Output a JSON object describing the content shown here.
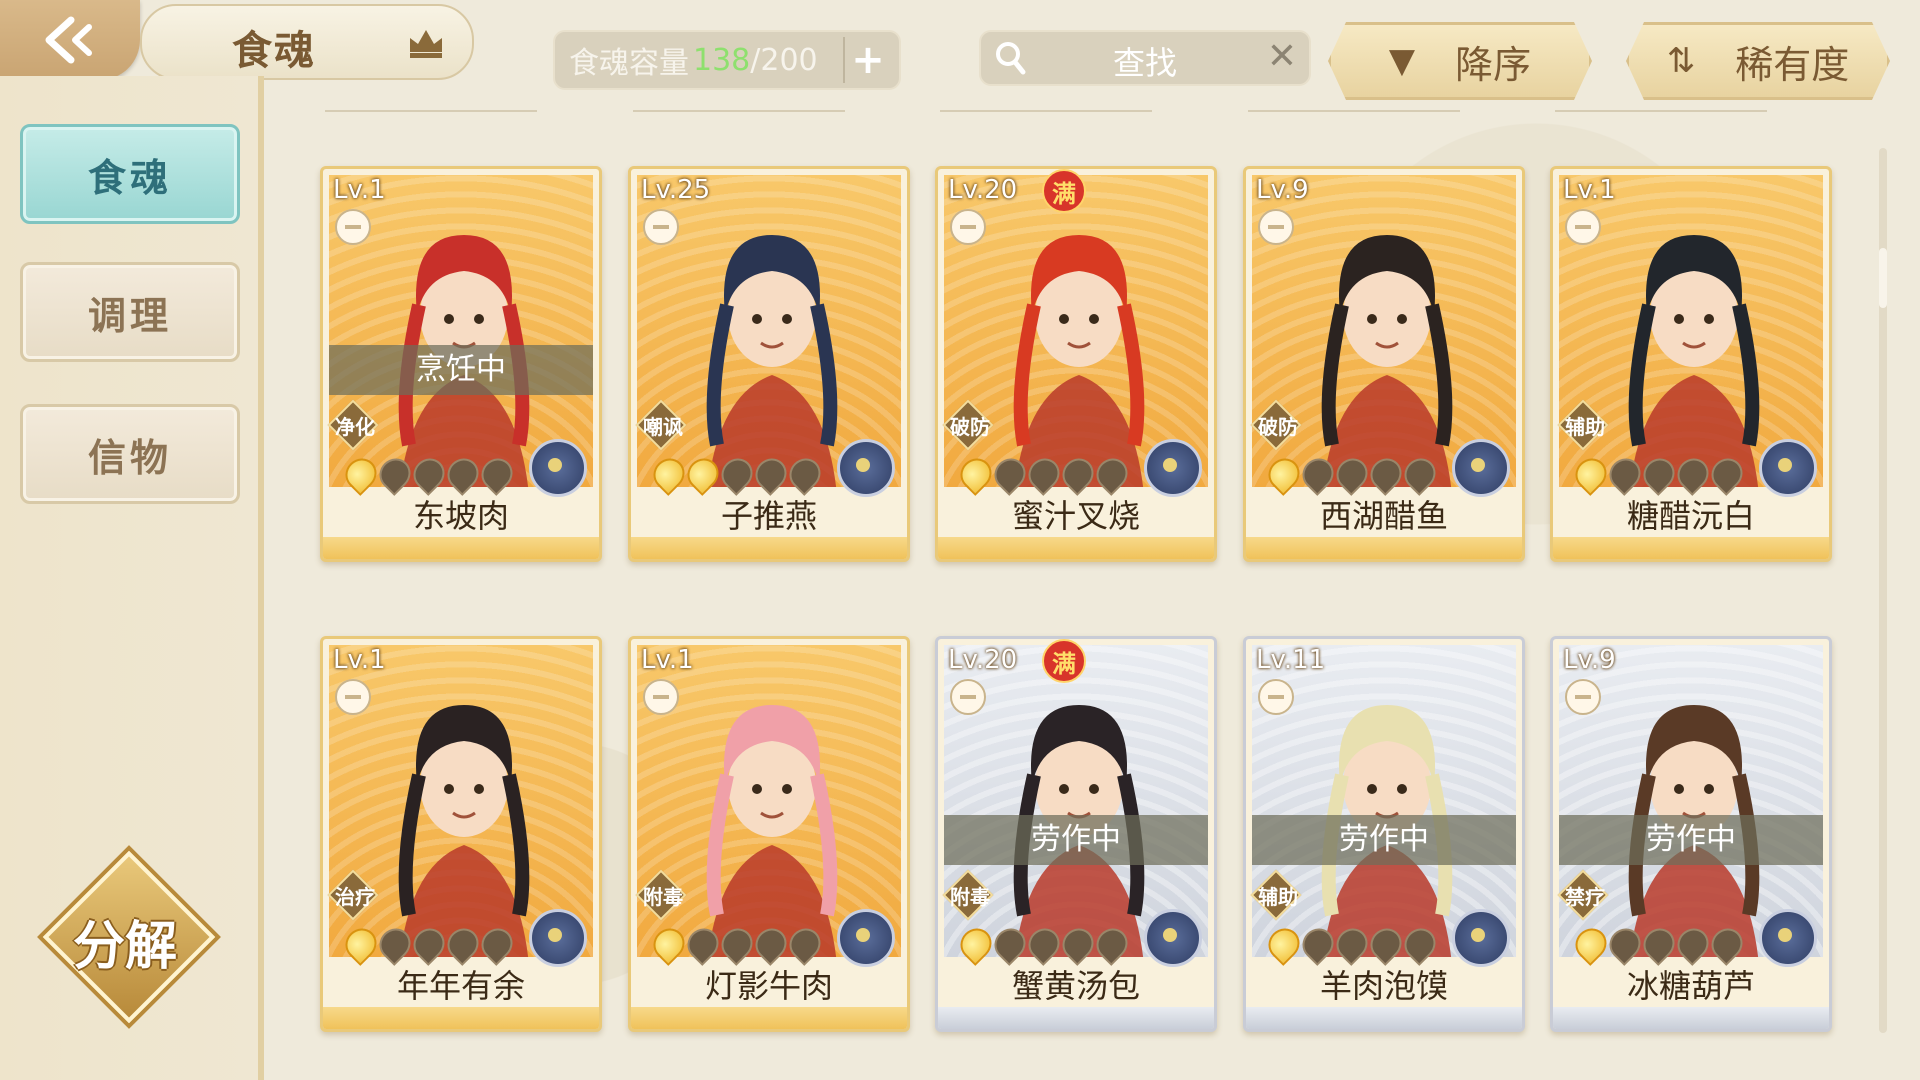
{
  "header": {
    "title": "食魂",
    "capacity_label": "食魂容量",
    "capacity_current": "138",
    "capacity_separator": "/",
    "capacity_max": "200",
    "add_label": "+",
    "search_placeholder": "查找",
    "clear_label": "✕",
    "sort_order_label": "降序",
    "sort_key_label": "稀有度"
  },
  "sidebar": {
    "items": [
      {
        "label": "食魂",
        "active": true
      },
      {
        "label": "调理",
        "active": false
      },
      {
        "label": "信物",
        "active": false
      }
    ],
    "decompose_label": "分解"
  },
  "cards": [
    {
      "level": "Lv.1",
      "name": "东坡肉",
      "role": "净化",
      "status": "烹饪中",
      "full": false,
      "stars": 1,
      "frame": "gold",
      "hair": "#c8302a"
    },
    {
      "level": "Lv.25",
      "name": "子推燕",
      "role": "嘲讽",
      "status": "",
      "full": false,
      "stars": 2,
      "frame": "gold",
      "hair": "#2a3552"
    },
    {
      "level": "Lv.20",
      "name": "蜜汁叉烧",
      "role": "破防",
      "status": "",
      "full": true,
      "stars": 1,
      "frame": "gold",
      "hair": "#d83a22"
    },
    {
      "level": "Lv.9",
      "name": "西湖醋鱼",
      "role": "破防",
      "status": "",
      "full": false,
      "stars": 1,
      "frame": "gold",
      "hair": "#2b2320"
    },
    {
      "level": "Lv.1",
      "name": "糖醋沅白",
      "role": "辅助",
      "status": "",
      "full": false,
      "stars": 1,
      "frame": "gold",
      "hair": "#22262c"
    },
    {
      "level": "Lv.1",
      "name": "年年有余",
      "role": "治疗",
      "status": "",
      "full": false,
      "stars": 1,
      "frame": "gold",
      "hair": "#2a2222"
    },
    {
      "level": "Lv.1",
      "name": "灯影牛肉",
      "role": "附毒",
      "status": "",
      "full": false,
      "stars": 1,
      "frame": "gold",
      "hair": "#f0a0a8"
    },
    {
      "level": "Lv.20",
      "name": "蟹黄汤包",
      "role": "附毒",
      "status": "劳作中",
      "full": true,
      "stars": 1,
      "frame": "silver",
      "hair": "#2a2326"
    },
    {
      "level": "Lv.11",
      "name": "羊肉泡馍",
      "role": "辅助",
      "status": "劳作中",
      "full": false,
      "stars": 1,
      "frame": "silver",
      "hair": "#e8e0b0"
    },
    {
      "level": "Lv.9",
      "name": "冰糖葫芦",
      "role": "禁疗",
      "status": "劳作中",
      "full": false,
      "stars": 1,
      "frame": "silver",
      "hair": "#5a3a26"
    }
  ],
  "full_badge": "满",
  "colors": {
    "accent_teal": "#98d6d2",
    "gold_frame": "#e9c979",
    "capacity_green": "#8ee06e"
  }
}
